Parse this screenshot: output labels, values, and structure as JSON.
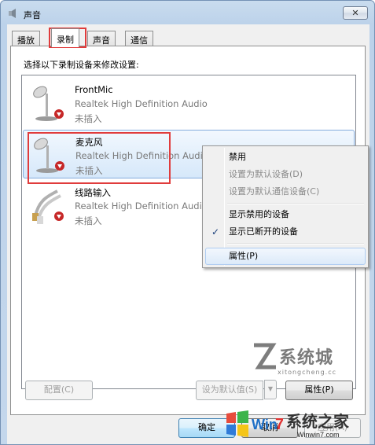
{
  "window": {
    "title": "声音",
    "close_label": "✕"
  },
  "tabs": [
    {
      "label": "播放",
      "active": false
    },
    {
      "label": "录制",
      "active": true
    },
    {
      "label": "声音",
      "active": false
    },
    {
      "label": "通信",
      "active": false
    }
  ],
  "panel": {
    "instruction": "选择以下录制设备来修改设置:"
  },
  "devices": [
    {
      "name": "FrontMic",
      "driver": "Realtek High Definition Audio",
      "status": "未插入",
      "icon": "microphone-icon"
    },
    {
      "name": "麦克风",
      "driver": "Realtek High Definition Audio",
      "status": "未插入",
      "icon": "microphone-icon"
    },
    {
      "name": "线路输入",
      "driver": "Realtek High Definition Audio",
      "status": "未插入",
      "icon": "line-in-cable-icon"
    }
  ],
  "context_menu": {
    "items": [
      {
        "label": "禁用",
        "disabled": false
      },
      {
        "label": "设置为默认设备(D)",
        "disabled": true
      },
      {
        "label": "设置为默认通信设备(C)",
        "disabled": true
      },
      {
        "label": "显示禁用的设备",
        "disabled": false
      },
      {
        "label": "显示已断开的设备",
        "checked": true
      },
      {
        "label": "属性(P)",
        "highlighted": true
      }
    ]
  },
  "panel_buttons": {
    "configure": "配置(C)",
    "set_default": "设为默认值(S)",
    "properties": "属性(P)"
  },
  "dialog_buttons": {
    "ok": "确定",
    "cancel": "取消",
    "apply": "应用(A)"
  },
  "watermarks": {
    "site1_text": "系统城",
    "site1_url": "xitongcheng.cc",
    "site2_text": "系统之家",
    "site2_url": "Winwin7.com"
  },
  "colors": {
    "highlight_box": "#e03c3c",
    "selection_bg": "#d6e8fa"
  }
}
